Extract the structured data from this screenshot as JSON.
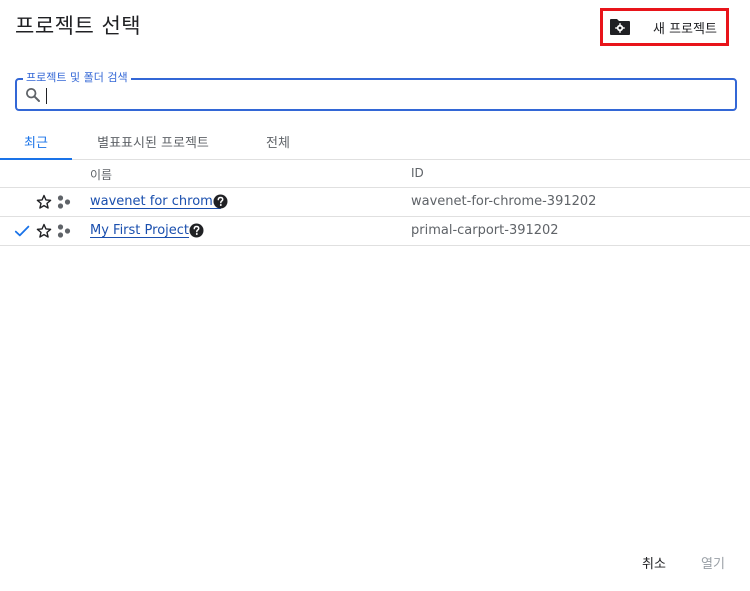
{
  "dialog": {
    "title": "프로젝트 선택",
    "new_project_label": "새 프로젝트"
  },
  "search": {
    "label": "프로젝트 및 폴더 검색",
    "value": "",
    "placeholder": ""
  },
  "tabs": [
    {
      "label": "최근",
      "active": true
    },
    {
      "label": "별표표시된 프로젝트",
      "active": false
    },
    {
      "label": "전체",
      "active": false
    }
  ],
  "table": {
    "columns": {
      "name": "이름",
      "id": "ID"
    },
    "rows": [
      {
        "name": "wavenet for chrome",
        "id": "wavenet-for-chrome-391202",
        "selected": false
      },
      {
        "name": "My First Project",
        "id": "primal-carport-391202",
        "selected": true
      }
    ]
  },
  "footer": {
    "cancel_label": "취소",
    "open_label": "열기"
  },
  "colors": {
    "accent": "#1a73e8",
    "highlight_border": "#e8141a",
    "link": "#1a4fae"
  },
  "icons": {
    "new_project": "folder-settings-icon",
    "search": "search-icon",
    "star": "star-outline-icon",
    "org": "project-tree-icon",
    "help": "help-circle-icon",
    "check": "checkmark-icon"
  }
}
